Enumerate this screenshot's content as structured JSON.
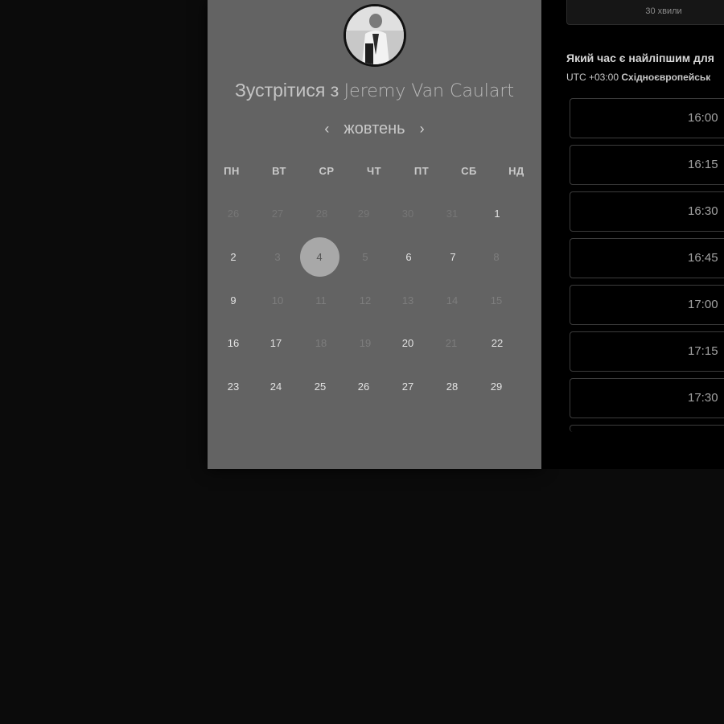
{
  "booking": {
    "title_prefix": "Зустрітися з",
    "host_name": "Jeremy Van Caulart"
  },
  "calendar": {
    "month": "жовтень",
    "prev_icon": "chevron-left-icon",
    "next_icon": "chevron-right-icon",
    "weekdays": [
      "ПН",
      "ВТ",
      "СР",
      "ЧТ",
      "ПТ",
      "СБ",
      "НД"
    ],
    "weeks": [
      [
        "26",
        "27",
        "28",
        "29",
        "30",
        "31",
        "1"
      ],
      [
        "2",
        "3",
        "4",
        "5",
        "6",
        "7",
        "8"
      ],
      [
        "9",
        "10",
        "11",
        "12",
        "13",
        "14",
        "15"
      ],
      [
        "16",
        "17",
        "18",
        "19",
        "20",
        "21",
        "22"
      ],
      [
        "23",
        "24",
        "25",
        "26",
        "27",
        "28",
        "29"
      ]
    ],
    "selected_day": "4"
  },
  "schedule": {
    "duration_label": "30 хвили",
    "question": "Який час є найліпшим для",
    "timezone_offset": "UTC +03:00",
    "timezone_name": "Східноєвропейськ",
    "slots": [
      "16:00",
      "16:15",
      "16:30",
      "16:45",
      "17:00",
      "17:15",
      "17:30"
    ]
  }
}
